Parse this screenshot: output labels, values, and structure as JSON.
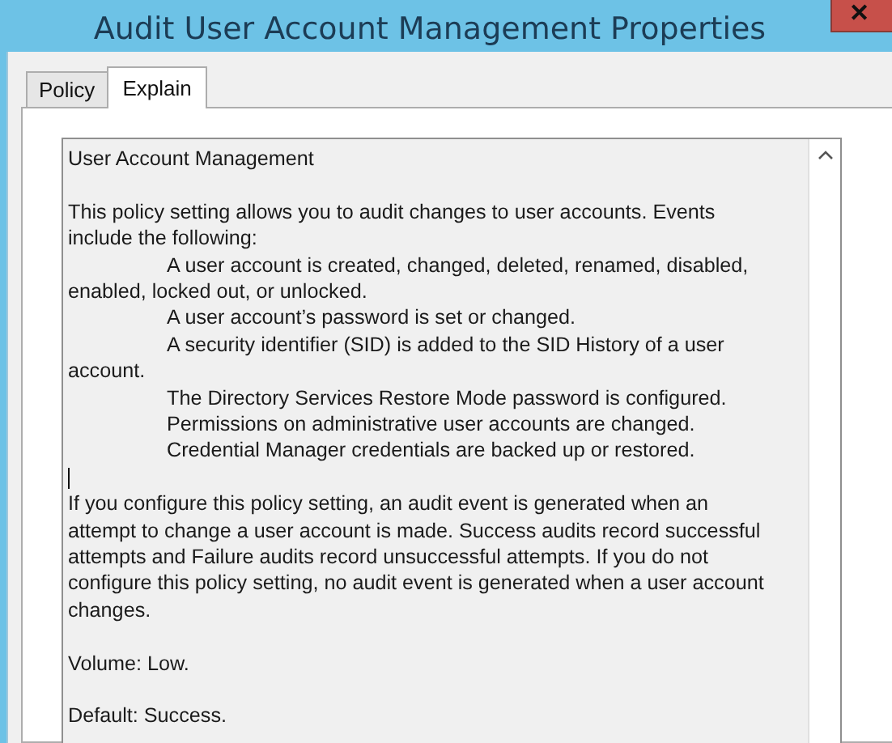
{
  "window": {
    "title": "Audit User Account Management Properties",
    "close": "✕"
  },
  "tabs": [
    {
      "label": "Policy",
      "selected": false
    },
    {
      "label": "Explain",
      "selected": true
    }
  ],
  "explain": {
    "heading": "User Account Management",
    "intro": "This policy setting allows you to audit changes to user accounts. Events include the following:",
    "events": [
      "A user account is created, changed, deleted, renamed, disabled, enabled, locked out, or unlocked.",
      "A user account’s password is set or changed.",
      "A security identifier (SID) is added to the SID History of a user account.",
      "The Directory Services Restore Mode password is configured.",
      "Permissions on administrative user accounts are changed.",
      "Credential Manager credentials are backed up or restored."
    ],
    "body": "If you configure this policy setting, an audit event is generated when an attempt to change a user account is made. Success audits record successful attempts and Failure audits record unsuccessful attempts. If you do not configure this policy setting, no audit event is generated when a user account changes.",
    "volume": "Volume: Low.",
    "default": "Default: Success."
  }
}
